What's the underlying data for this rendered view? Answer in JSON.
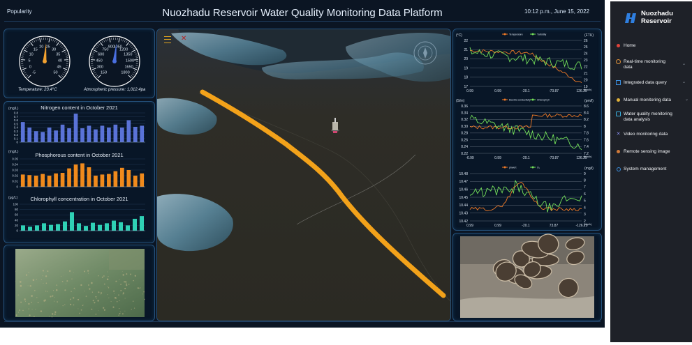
{
  "header": {
    "left_label": "Popularity",
    "title": "Nuozhadu Reservoir Water Quality Monitoring Data Platform",
    "datetime": "10:12 p.m., June 15, 2022"
  },
  "gauges": {
    "temperature": {
      "caption": "Temperature: 23.4°C",
      "value": 23.4,
      "ticks": [
        "-5",
        "0",
        "5",
        "10",
        "15",
        "20",
        "25",
        "30",
        "35",
        "40",
        "45",
        "50"
      ],
      "color": "#f2a130"
    },
    "pressure": {
      "caption": "Atmospheric pressure: 1,012.4pa",
      "value": 1012.4,
      "ticks": [
        "150",
        "300",
        "450",
        "600",
        "750",
        "900",
        "1050",
        "1200",
        "1350",
        "1500",
        "1650",
        "1800"
      ],
      "color": "#4a6fe0"
    }
  },
  "bar_charts": [
    {
      "title": "Nitrogen content in October 2021",
      "unit": "(mg/L)",
      "color": "#5a73d8",
      "yticks": [
        "0",
        "0.1",
        "0.2",
        "0.3",
        "0.4",
        "0.5",
        "0.6",
        "0.7",
        "0.8"
      ],
      "ymax": 0.8,
      "values": [
        0.55,
        0.4,
        0.3,
        0.28,
        0.4,
        0.32,
        0.48,
        0.38,
        0.78,
        0.38,
        0.45,
        0.35,
        0.45,
        0.4,
        0.48,
        0.4,
        0.6,
        0.42,
        0.45
      ]
    },
    {
      "title": "Phosphorous content in October 2021",
      "unit": "(mg/L)",
      "color": "#f08a1c",
      "yticks": [
        "0",
        "0.01",
        "0.02",
        "0.03",
        "0.04",
        "0.05"
      ],
      "ymax": 0.05,
      "values": [
        0.022,
        0.021,
        0.02,
        0.023,
        0.02,
        0.024,
        0.025,
        0.033,
        0.04,
        0.042,
        0.035,
        0.02,
        0.022,
        0.023,
        0.028,
        0.034,
        0.03,
        0.02,
        0.024
      ]
    },
    {
      "title": "Chlorophyll concentration in October 2021",
      "unit": "(μg/L)",
      "color": "#2fd1b5",
      "yticks": [
        "0",
        "20",
        "40",
        "60",
        "80",
        "100"
      ],
      "ymax": 100,
      "values": [
        20,
        15,
        20,
        28,
        22,
        25,
        35,
        70,
        28,
        18,
        30,
        22,
        28,
        38,
        32,
        20,
        45,
        55
      ]
    }
  ],
  "line_charts": [
    {
      "left_unit": "(°C)",
      "right_unit": "(FTU)",
      "legend": [
        "Temperature",
        "Turbidity"
      ],
      "left_ticks": [
        "17",
        "18",
        "19",
        "20",
        "21",
        "22"
      ],
      "right_ticks": [
        "19",
        "20",
        "21",
        "22",
        "23",
        "24",
        "25",
        "26"
      ],
      "x_ticks": [
        "0.99",
        "0.99",
        "-20.1",
        "-73.87",
        "126.29"
      ],
      "x_unit": "(Km/h)",
      "series_colors": [
        "#f07a26",
        "#74e05a"
      ]
    },
    {
      "left_unit": "(S/m)",
      "right_unit": "(pm/l)",
      "legend": [
        "Electric conductivity",
        "Chlorophyll"
      ],
      "left_ticks": [
        "0.22",
        "0.24",
        "0.26",
        "0.28",
        "0.30",
        "0.32",
        "0.34",
        "0.36"
      ],
      "right_ticks": [
        "7.2",
        "7.4",
        "7.6",
        "7.8",
        "8",
        "8.2",
        "8.4",
        "8.6"
      ],
      "x_ticks": [
        "-0.99",
        "0.99",
        "-20.1",
        "-73.87",
        "126.29"
      ],
      "x_unit": "(Km/h)",
      "series_colors": [
        "#f07a26",
        "#74e05a"
      ]
    },
    {
      "left_unit": "",
      "right_unit": "(mg/l)",
      "legend": [
        "phwert",
        "O₂"
      ],
      "left_ticks": [
        "10.42",
        "10.43",
        "10.44",
        "10.45",
        "10.46",
        "10.47",
        "10.48"
      ],
      "right_ticks": [
        "2",
        "3",
        "4",
        "5",
        "6",
        "7",
        "8",
        "9"
      ],
      "x_ticks": [
        "0.99",
        "0.99",
        "-20.1",
        "73.87",
        "-126.29"
      ],
      "x_unit": "(Km/h)",
      "series_colors": [
        "#f07a26",
        "#74e05a"
      ]
    }
  ],
  "sidebar": {
    "brand_line1": "Nuozhadu",
    "brand_line2": "Reservoir",
    "items": [
      {
        "label": "Home",
        "icon": "home-dot-icon",
        "color": "#e0433a",
        "expandable": false
      },
      {
        "label": "Real-time monitoring data",
        "icon": "realtime-icon",
        "color": "#e0933a",
        "expandable": true
      },
      {
        "label": "Integrated data query",
        "icon": "query-icon",
        "color": "#3a8fe0",
        "expandable": true
      },
      {
        "label": "Manual monitoring data",
        "icon": "manual-icon",
        "color": "#e0b13a",
        "expandable": true
      },
      {
        "label": "Water quality monitoring data analysis",
        "icon": "analysis-icon",
        "color": "#3ab0e0",
        "expandable": false
      },
      {
        "label": "Video monitoring data",
        "icon": "video-icon",
        "color": "#8a8ff0",
        "expandable": false
      },
      {
        "label": "Remote sensing image",
        "icon": "remote-sensing-icon",
        "color": "#d07a3a",
        "expandable": false
      },
      {
        "label": "System management",
        "icon": "settings-icon",
        "color": "#3a8fe0",
        "expandable": false
      }
    ]
  }
}
